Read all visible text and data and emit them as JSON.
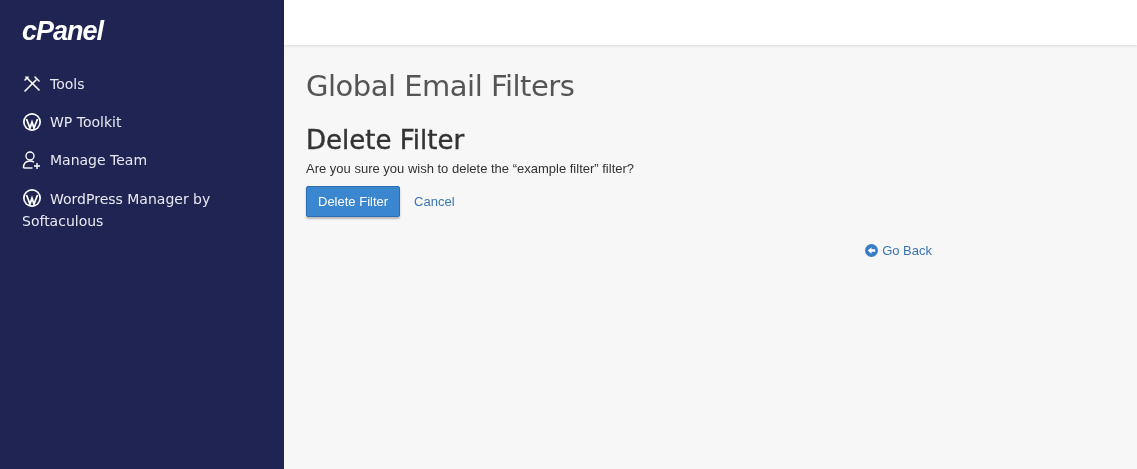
{
  "sidebar": {
    "logo": "cPanel",
    "items": [
      {
        "label": "Tools",
        "kind": "tools"
      },
      {
        "label": "WP Toolkit",
        "kind": "wordpress"
      },
      {
        "label": "Manage Team",
        "kind": "team"
      },
      {
        "label": "WordPress Manager by Softaculous",
        "kind": "wordpress"
      }
    ]
  },
  "page_title": "Global Email Filters",
  "heading": "Delete Filter",
  "message": "Are you sure you wish to delete the “example filter” filter?",
  "buttons": {
    "confirm": "Delete Filter",
    "cancel": "Cancel"
  },
  "go_back": "Go Back"
}
